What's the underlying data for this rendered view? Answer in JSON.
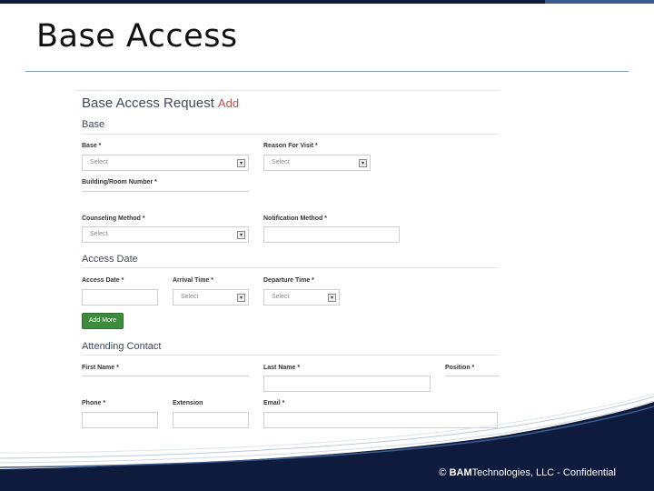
{
  "slide": {
    "title": "Base Access",
    "footer_copyright": "©",
    "footer_brand": "BAM",
    "footer_rest": "Technologies, LLC - Confidential"
  },
  "form": {
    "title": "Base Access Request",
    "title_action": "Add",
    "sections": {
      "base": "Base",
      "access_date": "Access Date",
      "attending_contact": "Attending Contact"
    },
    "fields": {
      "base": {
        "label": "Base *",
        "placeholder": "Select"
      },
      "reason": {
        "label": "Reason For Visit *",
        "placeholder": "Select"
      },
      "building": {
        "label": "Building/Room Number *"
      },
      "counseling": {
        "label": "Counseling Method *",
        "placeholder": "Select"
      },
      "notification": {
        "label": "Notification Method *"
      },
      "access_date": {
        "label": "Access Date *"
      },
      "arrival": {
        "label": "Arrival Time *",
        "placeholder": "Select"
      },
      "departure": {
        "label": "Departure Time *",
        "placeholder": "Select"
      },
      "first_name": {
        "label": "First Name *"
      },
      "last_name": {
        "label": "Last Name *"
      },
      "position": {
        "label": "Position *"
      },
      "phone": {
        "label": "Phone *"
      },
      "extension": {
        "label": "Extension"
      },
      "email": {
        "label": "Email *"
      }
    },
    "add_more_label": "Add More"
  },
  "colors": {
    "navy": "#0f1b3d",
    "add_red": "#c0504d",
    "button_green": "#3d8b3d"
  }
}
